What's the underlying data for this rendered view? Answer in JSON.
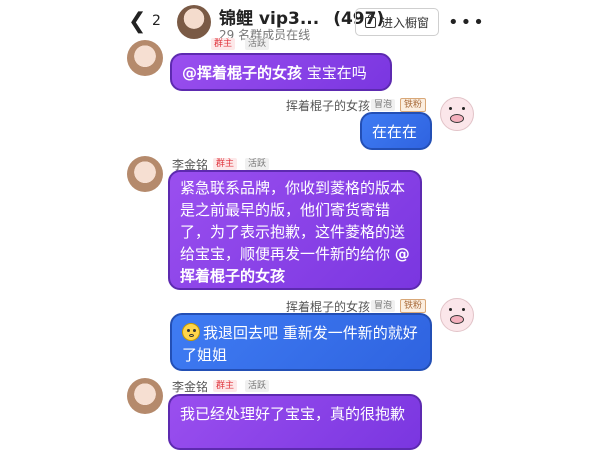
{
  "header": {
    "back_icon": "chevron-left-icon",
    "unread_count": "2",
    "title": "锦鲤 vip3...",
    "member_count": "(497)",
    "subtitle": "29 名群成员在线",
    "window_button_label": "进入橱窗",
    "more_icon": "more-dots-icon"
  },
  "colors": {
    "purple_bubble": "#8a44ea",
    "blue_bubble": "#3670ea",
    "owner_tag": "#e0373f"
  },
  "messages": [
    {
      "sender": "",
      "badge_owner": "群主",
      "badge_active": "活跃",
      "mention": "@挥着棍子的女孩",
      "text": " 宝宝在吗"
    },
    {
      "sender": "挥着棍子的女孩",
      "badge_bubble": "冒泡",
      "badge_iron": "铁粉",
      "text": "在在在"
    },
    {
      "sender": "李金铭",
      "badge_owner": "群主",
      "badge_active": "活跃",
      "text": "紧急联系品牌，你收到菱格的版本是之前最早的版，他们寄货寄错了，为了表示抱歉，这件菱格的送给宝宝，顺便再发一件新的给你 ",
      "mention": "@挥着棍子的女孩"
    },
    {
      "sender": "挥着棍子的女孩",
      "badge_bubble": "冒泡",
      "badge_iron": "铁粉",
      "emoji": "smile-emoji",
      "text": "我退回去吧 重新发一件新的就好了姐姐"
    },
    {
      "sender": "李金铭",
      "badge_owner": "群主",
      "badge_active": "活跃",
      "text": "我已经处理好了宝宝，真的很抱歉"
    }
  ]
}
